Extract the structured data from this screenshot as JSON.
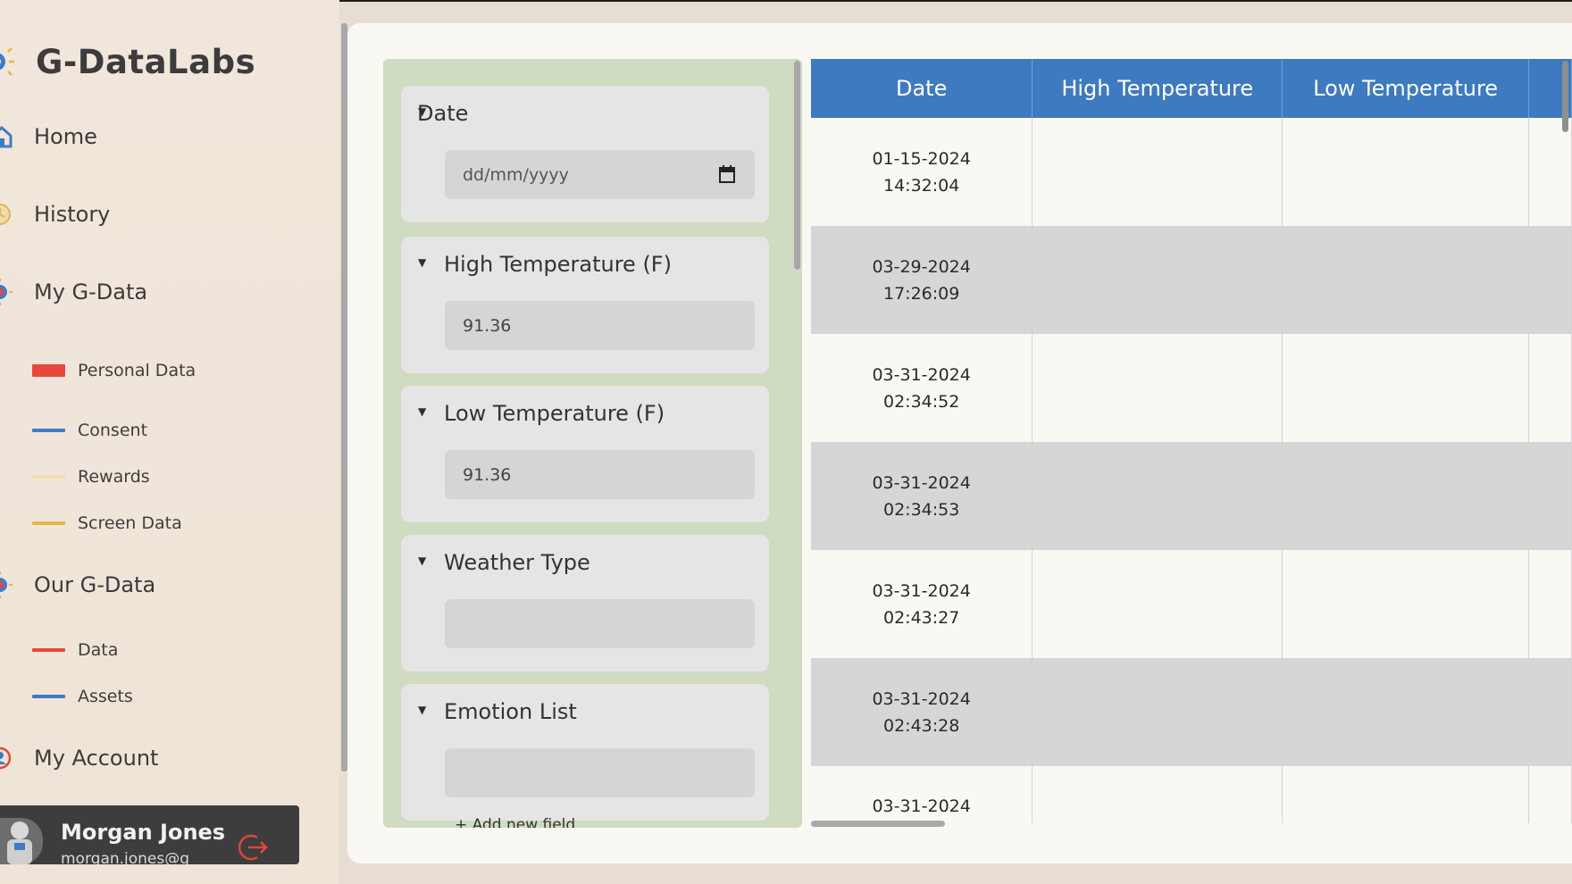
{
  "app": {
    "brand": "G-DataLabs"
  },
  "sidebar": {
    "nav": [
      {
        "label": "Home",
        "icon": "home-icon"
      },
      {
        "label": "History",
        "icon": "history-icon"
      },
      {
        "label": "My G-Data",
        "icon": "g-data-icon"
      }
    ],
    "my_gdata_items": [
      {
        "label": "Personal Data",
        "color": "#e8473b"
      },
      {
        "label": "Consent",
        "color": "#3f7cc4"
      },
      {
        "label": "Rewards",
        "color": "#f1dcae"
      },
      {
        "label": "Screen Data",
        "color": "#e2b64d"
      }
    ],
    "our_gdata": {
      "label": "Our G-Data",
      "icon": "g-data-icon"
    },
    "our_gdata_items": [
      {
        "label": "Data",
        "color": "#e8473b"
      },
      {
        "label": "Assets",
        "color": "#3f7cc4"
      }
    ],
    "account": {
      "label": "My Account",
      "icon": "account-icon"
    },
    "user": {
      "name": "Morgan Jones",
      "email": "morgan.jones@g"
    }
  },
  "form": {
    "fields": [
      {
        "label": "Date",
        "value": "",
        "placeholder": "dd/mm/yyyy"
      },
      {
        "label": "High Temperature (F)",
        "value": "91.36",
        "placeholder": ""
      },
      {
        "label": "Low Temperature (F)",
        "value": "91.36",
        "placeholder": ""
      },
      {
        "label": "Weather Type",
        "value": "",
        "placeholder": ""
      },
      {
        "label": "Emotion List",
        "value": "",
        "placeholder": ""
      }
    ],
    "add_field_label": "+ Add new field"
  },
  "table": {
    "columns": [
      "Date",
      "High Temperature",
      "Low Temperature",
      ""
    ],
    "rows": [
      {
        "date": "01-15-2024",
        "time": "14:32:04"
      },
      {
        "date": "03-29-2024",
        "time": "17:26:09"
      },
      {
        "date": "03-31-2024",
        "time": "02:34:52"
      },
      {
        "date": "03-31-2024",
        "time": "02:34:53"
      },
      {
        "date": "03-31-2024",
        "time": "02:43:27"
      },
      {
        "date": "03-31-2024",
        "time": "02:43:28"
      },
      {
        "date": "03-31-2024",
        "time": ""
      }
    ]
  },
  "colors": {
    "header_blue": "#3e7abf",
    "form_panel_green": "#cfdcc1",
    "user_card": "#3d3d3d",
    "logout_red": "#e2443b"
  }
}
